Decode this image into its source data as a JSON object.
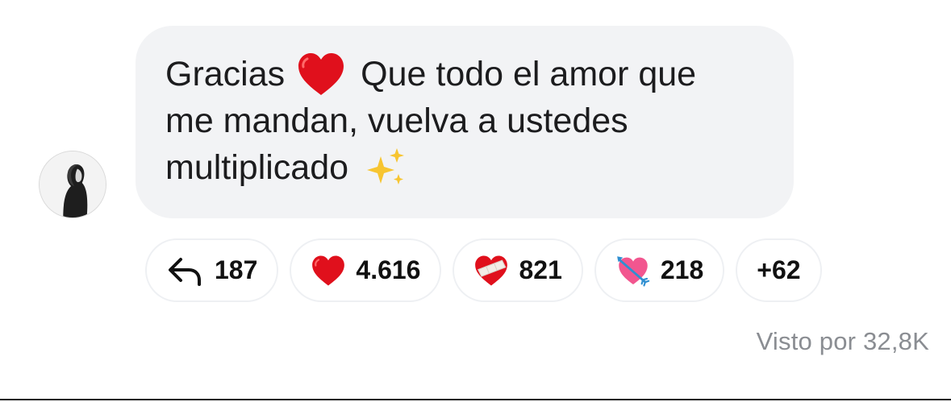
{
  "message": {
    "lines": [
      {
        "before": "Gracias",
        "emoji": "red-heart",
        "after": "Que todo el amor que"
      },
      {
        "text": "me mandan, vuelva a ustedes"
      },
      {
        "text": "multiplicado",
        "emoji": "sparkles"
      }
    ]
  },
  "reactions": [
    {
      "icon": "reply-arrow-icon",
      "count": "187"
    },
    {
      "icon": "red-heart-icon",
      "count": "4.616"
    },
    {
      "icon": "mending-heart-icon",
      "count": "821"
    },
    {
      "icon": "heart-with-arrow-icon",
      "count": "218"
    },
    {
      "icon": "",
      "count": "+62"
    }
  ],
  "seen_by": "Visto por 32,8K",
  "colors": {
    "bubble_background": "#f2f3f5",
    "pill_border": "#eef0f3",
    "heart_red": "#e0101c",
    "seen_text": "#8a8d92"
  }
}
